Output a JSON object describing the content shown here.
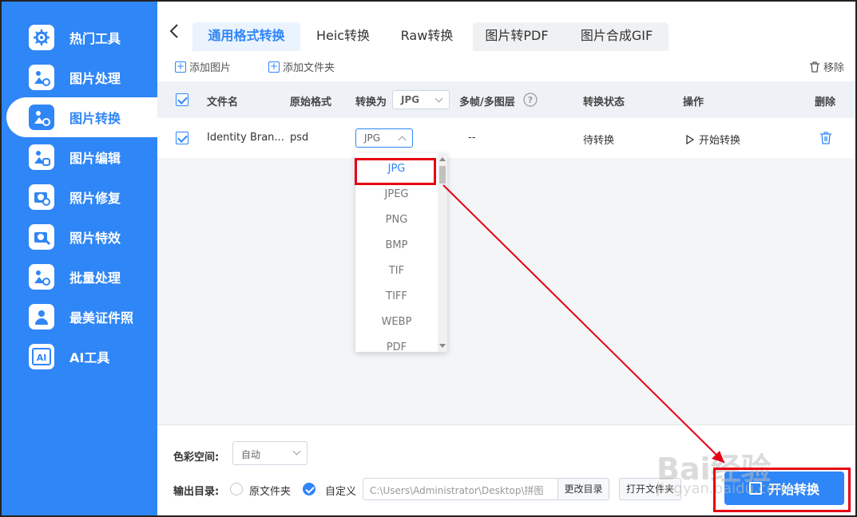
{
  "sidebar": {
    "items": [
      {
        "label": "热门工具",
        "icon": "gear-icon"
      },
      {
        "label": "图片处理",
        "icon": "image-process-icon"
      },
      {
        "label": "图片转换",
        "icon": "image-convert-icon"
      },
      {
        "label": "图片编辑",
        "icon": "image-edit-icon"
      },
      {
        "label": "照片修复",
        "icon": "photo-repair-icon"
      },
      {
        "label": "照片特效",
        "icon": "photo-effect-icon"
      },
      {
        "label": "批量处理",
        "icon": "batch-icon"
      },
      {
        "label": "最美证件照",
        "icon": "id-photo-icon"
      },
      {
        "label": "AI工具",
        "icon": "ai-icon"
      }
    ],
    "active_index": 2,
    "accent": "#2f86f6"
  },
  "tabs": [
    "通用格式转换",
    "Heic转换",
    "Raw转换",
    "图片转PDF",
    "图片合成GIF"
  ],
  "toolbar": {
    "add_image": "添加图片",
    "add_folder": "添加文件夹",
    "remove": "移除"
  },
  "table": {
    "headers": {
      "filename": "文件名",
      "original_format": "原始格式",
      "convert_to": "转换为",
      "convert_to_value": "JPG",
      "multi_frame": "多帧/多图层",
      "status": "转换状态",
      "action": "操作",
      "delete": "删除"
    },
    "rows": [
      {
        "filename": "Identity Bran...",
        "original_format": "psd",
        "convert_to": "JPG",
        "multi_frame": "--",
        "status": "待转换",
        "action": "开始转换"
      }
    ]
  },
  "dropdown": {
    "options": [
      "JPG",
      "JPEG",
      "PNG",
      "BMP",
      "TIF",
      "TIFF",
      "WEBP",
      "PDF"
    ],
    "selected": "JPG"
  },
  "footer": {
    "color_space_label": "色彩空间:",
    "color_space_value": "自动",
    "output_label": "输出目录:",
    "radio_original": "原文件夹",
    "radio_custom": "自定义",
    "path_value": "C:\\Users\\Administrator\\Desktop\\拼图",
    "change_dir": "更改目录",
    "open_folder": "打开文件夹",
    "start_button": "开始转换"
  },
  "watermark": {
    "text": "Bai经验",
    "url": "jingyan.baidu.com"
  },
  "annotation_color": "#e60012"
}
